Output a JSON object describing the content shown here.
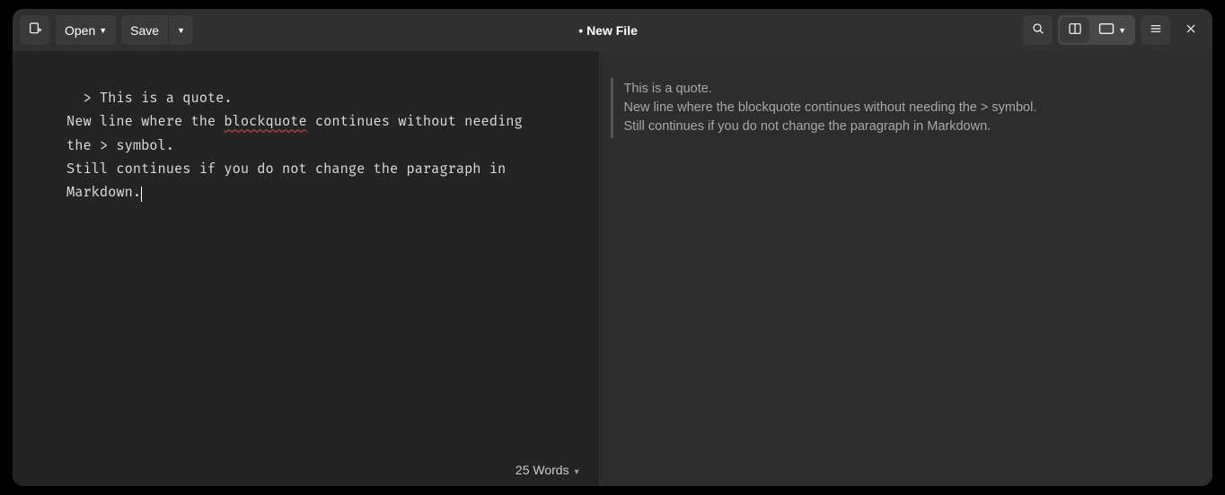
{
  "toolbar": {
    "open_label": "Open",
    "save_label": "Save",
    "title": "• New File"
  },
  "editor": {
    "line1": "  > This is a quote.",
    "line2a": "New line where the ",
    "line2_spellword": "blockquote",
    "line2b": " continues without needing the > symbol.",
    "line3": "Still continues if you do not change the paragraph in Markdown."
  },
  "preview": {
    "line1": "This is a quote.",
    "line2": "New line where the blockquote continues without needing the > symbol.",
    "line3": "Still continues if you do not change the paragraph in Markdown."
  },
  "status": {
    "word_count": "25 Words"
  }
}
